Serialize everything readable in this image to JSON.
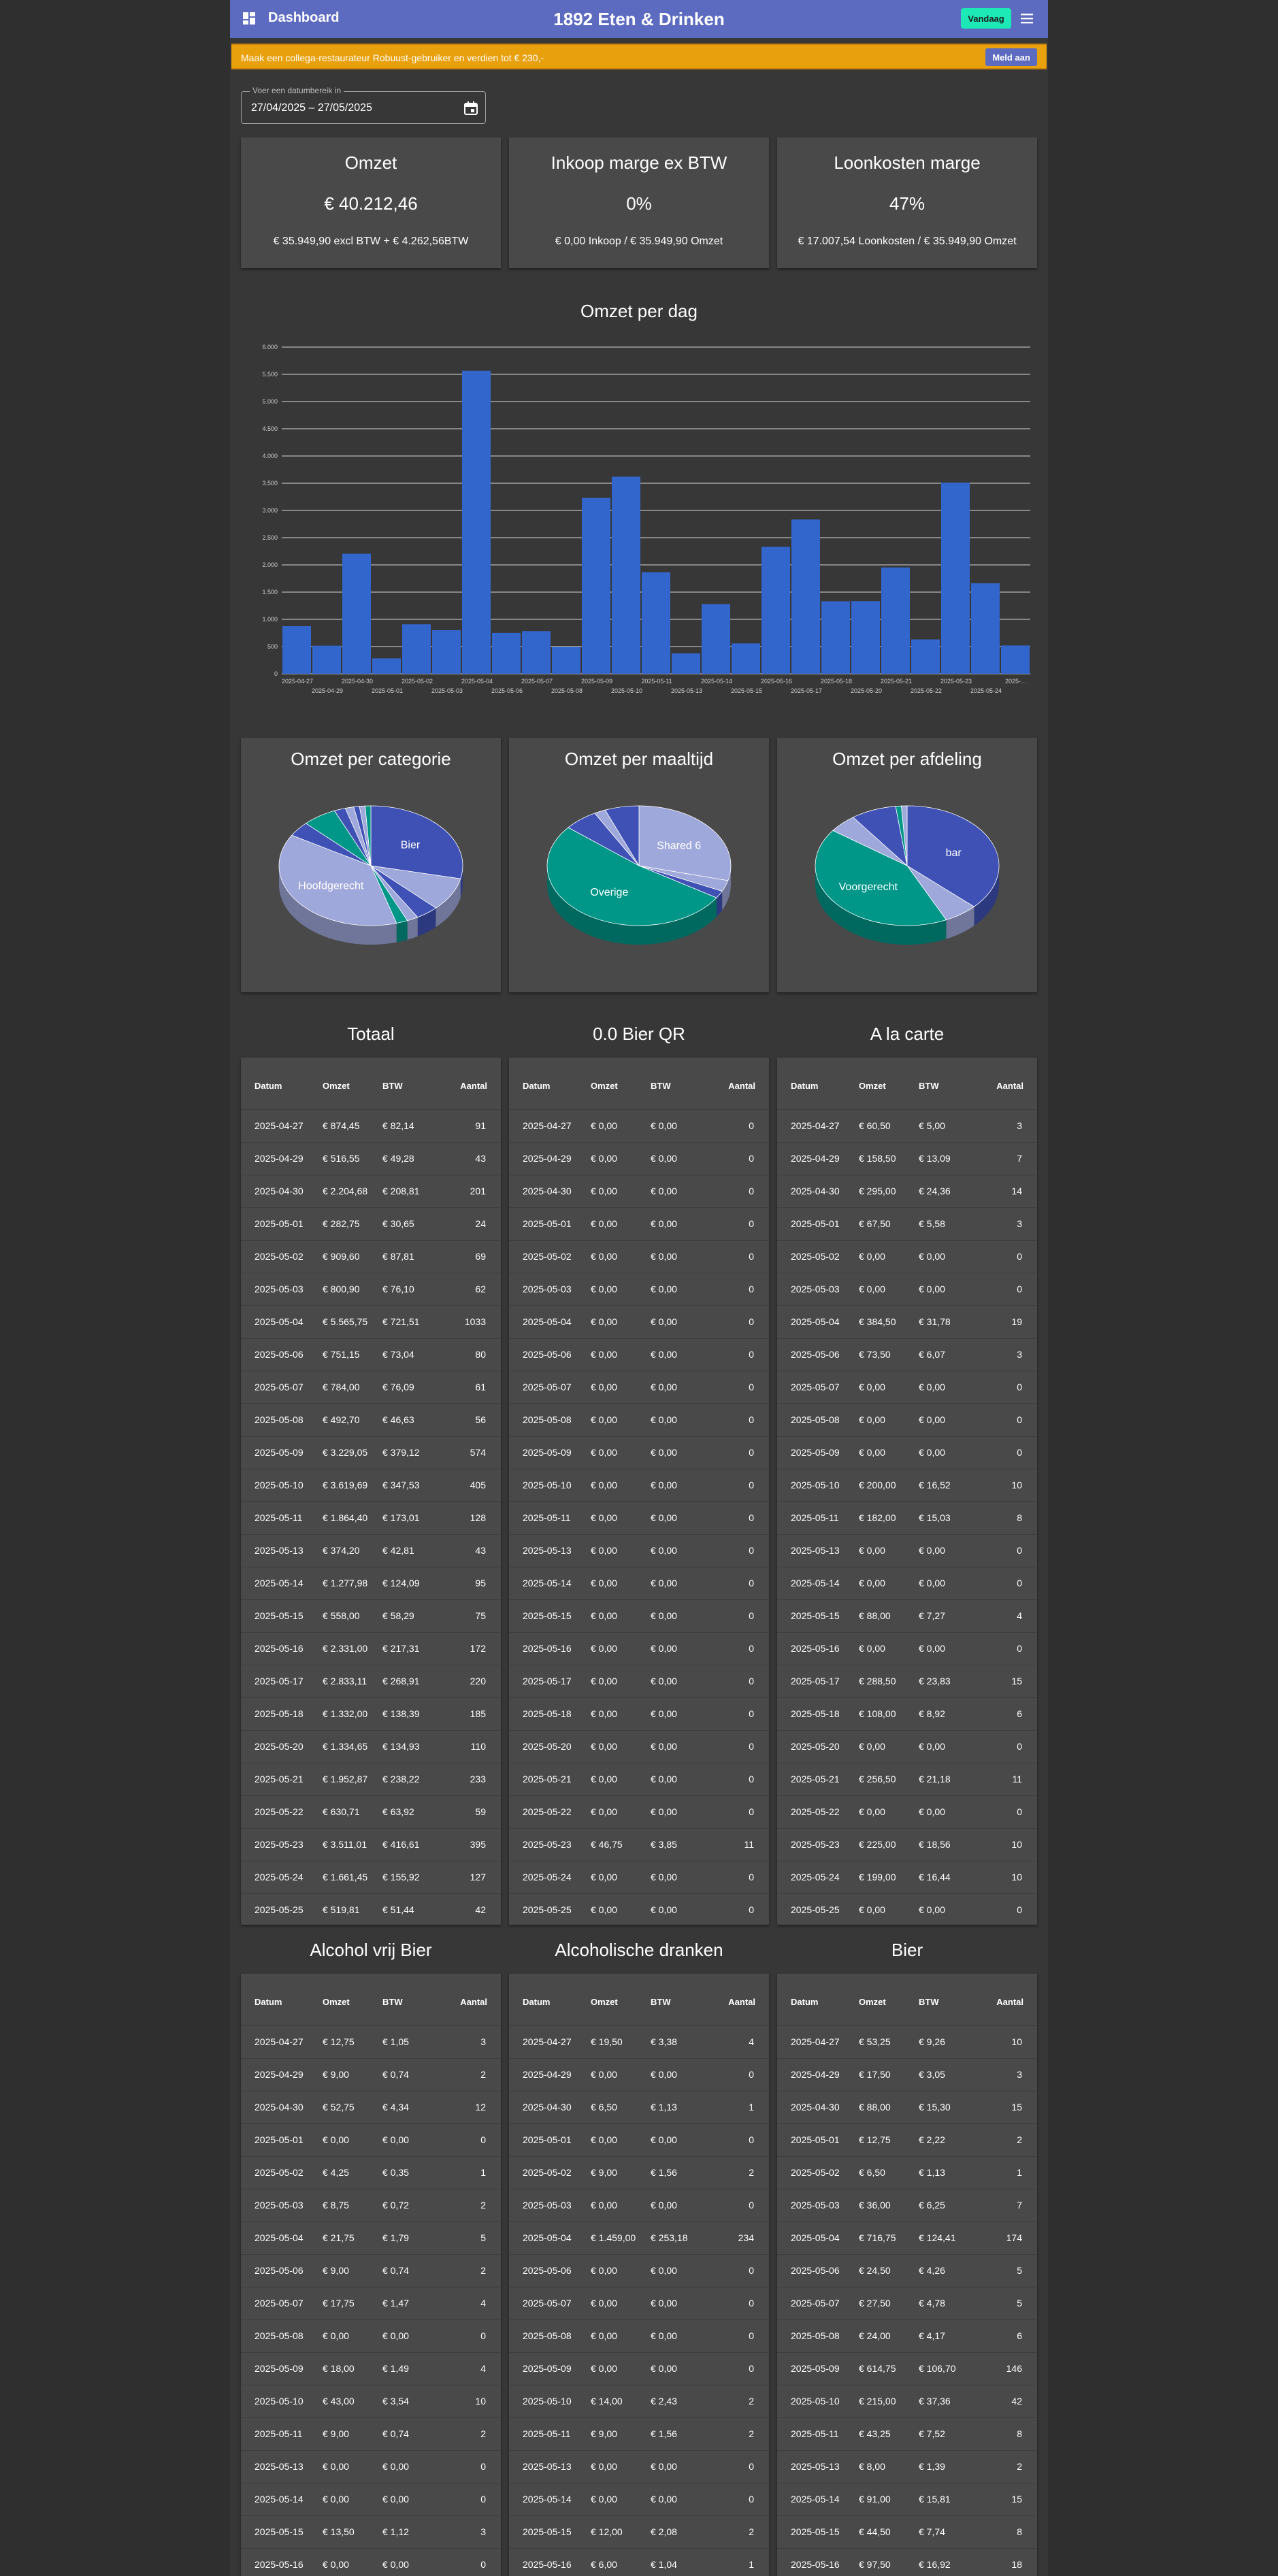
{
  "header": {
    "dashboard_label": "Dashboard",
    "title": "1892 Eten & Drinken",
    "today_button": "Vandaag",
    "dashboard_icon": "dashboard-icon",
    "menu_icon": "hamburger-menu-icon"
  },
  "promo": {
    "text": "Maak een collega-restaurateur Robuust-gebruiker en verdien tot € 230,-",
    "button": "Meld aan"
  },
  "date_range": {
    "label": "Voer een datumbereik in",
    "value": "27/04/2025  –  27/05/2025",
    "icon": "calendar-icon"
  },
  "kpis": [
    {
      "title": "Omzet",
      "value": "€ 40.212,46",
      "sub": "€ 35.949,90 excl BTW + € 4.262,56BTW"
    },
    {
      "title": "Inkoop marge ex BTW",
      "value": "0%",
      "sub": "€ 0,00 Inkoop / € 35.949,90 Omzet"
    },
    {
      "title": "Loonkosten marge",
      "value": "47%",
      "sub": "€ 17.007,54 Loonkosten / € 35.949,90 Omzet"
    }
  ],
  "colors": {
    "accent": "#5c6bc0",
    "bar": "#3366cc",
    "promo": "#e8a00d",
    "today": "#1de9b6"
  },
  "bar_chart_title": "Omzet per dag",
  "chart_data": [
    {
      "type": "bar",
      "title": "Omzet per dag",
      "categories": [
        "2025-04-27",
        "2025-04-29",
        "2025-04-30",
        "2025-05-01",
        "2025-05-02",
        "2025-05-03",
        "2025-05-04",
        "2025-05-06",
        "2025-05-07",
        "2025-05-08",
        "2025-05-09",
        "2025-05-10",
        "2025-05-11",
        "2025-05-13",
        "2025-05-14",
        "2025-05-15",
        "2025-05-16",
        "2025-05-17",
        "2025-05-18",
        "2025-05-20",
        "2025-05-21",
        "2025-05-22",
        "2025-05-23",
        "2025-05-24",
        "2025-05-25"
      ],
      "tick_labels_shown": [
        "2025-04-27",
        "2025-04-29",
        "2025-04-30",
        "2025-05-01",
        "2025-05-02",
        "2025-05-03",
        "2025-05-04",
        "2025-05-06",
        "2025-05-07",
        "2025-05-08",
        "2025-05-09",
        "2025-05-10",
        "2025-05-11",
        "2025-05-13",
        "2025-05-14",
        "2025-05-15",
        "2025-05-16",
        "2025-05-17",
        "2025-05-18",
        "2025-05-20",
        "2025-05-21",
        "2025-05-22",
        "2025-05-23",
        "2025-05-24",
        "2025-…"
      ],
      "values": [
        874.45,
        516.55,
        2204.68,
        282.75,
        909.6,
        800.9,
        5565.75,
        751.15,
        784.0,
        492.7,
        3229.05,
        3619.69,
        1864.4,
        374.2,
        1277.98,
        558.0,
        2331.0,
        2833.11,
        1332.0,
        1334.65,
        1952.87,
        630.71,
        3511.01,
        1661.45,
        519.81
      ],
      "y_ticks": [
        "6.000",
        "5.500",
        "5.000",
        "4.500",
        "4.000",
        "3.500",
        "3.000",
        "2.500",
        "2.000",
        "1.500",
        "1.000",
        "500",
        "0"
      ],
      "ylim": [
        0,
        6000
      ],
      "grid": true
    },
    {
      "type": "pie",
      "title": "Omzet per categorie",
      "slices": [
        {
          "label": "Bier",
          "value": 28.5
        },
        {
          "label": "",
          "value": 9
        },
        {
          "label": "",
          "value": 4
        },
        {
          "label": "",
          "value": 2
        },
        {
          "label": "",
          "value": 2
        },
        {
          "label": "Hoofdgerecht",
          "value": 38
        },
        {
          "label": "",
          "value": 4
        },
        {
          "label": "",
          "value": 6
        },
        {
          "label": "",
          "value": 2
        },
        {
          "label": "",
          "value": 1.5
        },
        {
          "label": "",
          "value": 1
        },
        {
          "label": "",
          "value": 1
        },
        {
          "label": "",
          "value": 1
        }
      ]
    },
    {
      "type": "pie",
      "title": "Omzet per maaltijd",
      "slices": [
        {
          "label": "Shared 6",
          "value": 29
        },
        {
          "label": "",
          "value": 3
        },
        {
          "label": "",
          "value": 2
        },
        {
          "label": "Overige",
          "value": 52
        },
        {
          "label": "",
          "value": 6
        },
        {
          "label": "",
          "value": 2
        },
        {
          "label": "",
          "value": 6
        }
      ]
    },
    {
      "type": "pie",
      "title": "Omzet per afdeling",
      "slices": [
        {
          "label": "bar",
          "value": 37
        },
        {
          "label": "",
          "value": 6
        },
        {
          "label": "Voorgerecht",
          "value": 42
        },
        {
          "label": "",
          "value": 5
        },
        {
          "label": "",
          "value": 8
        },
        {
          "label": "",
          "value": 1
        },
        {
          "label": "",
          "value": 1
        }
      ]
    }
  ],
  "table_headers": [
    "Datum",
    "Omzet",
    "BTW",
    "Aantal"
  ],
  "tables": [
    {
      "title": "Totaal",
      "rows": [
        [
          "2025-04-27",
          "€ 874,45",
          "€ 82,14",
          "91"
        ],
        [
          "2025-04-29",
          "€ 516,55",
          "€ 49,28",
          "43"
        ],
        [
          "2025-04-30",
          "€ 2.204,68",
          "€ 208,81",
          "201"
        ],
        [
          "2025-05-01",
          "€ 282,75",
          "€ 30,65",
          "24"
        ],
        [
          "2025-05-02",
          "€ 909,60",
          "€ 87,81",
          "69"
        ],
        [
          "2025-05-03",
          "€ 800,90",
          "€ 76,10",
          "62"
        ],
        [
          "2025-05-04",
          "€ 5.565,75",
          "€ 721,51",
          "1033"
        ],
        [
          "2025-05-06",
          "€ 751,15",
          "€ 73,04",
          "80"
        ],
        [
          "2025-05-07",
          "€ 784,00",
          "€ 76,09",
          "61"
        ],
        [
          "2025-05-08",
          "€ 492,70",
          "€ 46,63",
          "56"
        ],
        [
          "2025-05-09",
          "€ 3.229,05",
          "€ 379,12",
          "574"
        ],
        [
          "2025-05-10",
          "€ 3.619,69",
          "€ 347,53",
          "405"
        ],
        [
          "2025-05-11",
          "€ 1.864,40",
          "€ 173,01",
          "128"
        ],
        [
          "2025-05-13",
          "€ 374,20",
          "€ 42,81",
          "43"
        ],
        [
          "2025-05-14",
          "€ 1.277,98",
          "€ 124,09",
          "95"
        ],
        [
          "2025-05-15",
          "€ 558,00",
          "€ 58,29",
          "75"
        ],
        [
          "2025-05-16",
          "€ 2.331,00",
          "€ 217,31",
          "172"
        ],
        [
          "2025-05-17",
          "€ 2.833,11",
          "€ 268,91",
          "220"
        ],
        [
          "2025-05-18",
          "€ 1.332,00",
          "€ 138,39",
          "185"
        ],
        [
          "2025-05-20",
          "€ 1.334,65",
          "€ 134,93",
          "110"
        ],
        [
          "2025-05-21",
          "€ 1.952,87",
          "€ 238,22",
          "233"
        ],
        [
          "2025-05-22",
          "€ 630,71",
          "€ 63,92",
          "59"
        ],
        [
          "2025-05-23",
          "€ 3.511,01",
          "€ 416,61",
          "395"
        ],
        [
          "2025-05-24",
          "€ 1.661,45",
          "€ 155,92",
          "127"
        ],
        [
          "2025-05-25",
          "€ 519,81",
          "€ 51,44",
          "42"
        ]
      ]
    },
    {
      "title": "0.0 Bier QR",
      "rows": [
        [
          "2025-04-27",
          "€ 0,00",
          "€ 0,00",
          "0"
        ],
        [
          "2025-04-29",
          "€ 0,00",
          "€ 0,00",
          "0"
        ],
        [
          "2025-04-30",
          "€ 0,00",
          "€ 0,00",
          "0"
        ],
        [
          "2025-05-01",
          "€ 0,00",
          "€ 0,00",
          "0"
        ],
        [
          "2025-05-02",
          "€ 0,00",
          "€ 0,00",
          "0"
        ],
        [
          "2025-05-03",
          "€ 0,00",
          "€ 0,00",
          "0"
        ],
        [
          "2025-05-04",
          "€ 0,00",
          "€ 0,00",
          "0"
        ],
        [
          "2025-05-06",
          "€ 0,00",
          "€ 0,00",
          "0"
        ],
        [
          "2025-05-07",
          "€ 0,00",
          "€ 0,00",
          "0"
        ],
        [
          "2025-05-08",
          "€ 0,00",
          "€ 0,00",
          "0"
        ],
        [
          "2025-05-09",
          "€ 0,00",
          "€ 0,00",
          "0"
        ],
        [
          "2025-05-10",
          "€ 0,00",
          "€ 0,00",
          "0"
        ],
        [
          "2025-05-11",
          "€ 0,00",
          "€ 0,00",
          "0"
        ],
        [
          "2025-05-13",
          "€ 0,00",
          "€ 0,00",
          "0"
        ],
        [
          "2025-05-14",
          "€ 0,00",
          "€ 0,00",
          "0"
        ],
        [
          "2025-05-15",
          "€ 0,00",
          "€ 0,00",
          "0"
        ],
        [
          "2025-05-16",
          "€ 0,00",
          "€ 0,00",
          "0"
        ],
        [
          "2025-05-17",
          "€ 0,00",
          "€ 0,00",
          "0"
        ],
        [
          "2025-05-18",
          "€ 0,00",
          "€ 0,00",
          "0"
        ],
        [
          "2025-05-20",
          "€ 0,00",
          "€ 0,00",
          "0"
        ],
        [
          "2025-05-21",
          "€ 0,00",
          "€ 0,00",
          "0"
        ],
        [
          "2025-05-22",
          "€ 0,00",
          "€ 0,00",
          "0"
        ],
        [
          "2025-05-23",
          "€ 46,75",
          "€ 3,85",
          "11"
        ],
        [
          "2025-05-24",
          "€ 0,00",
          "€ 0,00",
          "0"
        ],
        [
          "2025-05-25",
          "€ 0,00",
          "€ 0,00",
          "0"
        ]
      ]
    },
    {
      "title": "A la carte",
      "rows": [
        [
          "2025-04-27",
          "€ 60,50",
          "€ 5,00",
          "3"
        ],
        [
          "2025-04-29",
          "€ 158,50",
          "€ 13,09",
          "7"
        ],
        [
          "2025-04-30",
          "€ 295,00",
          "€ 24,36",
          "14"
        ],
        [
          "2025-05-01",
          "€ 67,50",
          "€ 5,58",
          "3"
        ],
        [
          "2025-05-02",
          "€ 0,00",
          "€ 0,00",
          "0"
        ],
        [
          "2025-05-03",
          "€ 0,00",
          "€ 0,00",
          "0"
        ],
        [
          "2025-05-04",
          "€ 384,50",
          "€ 31,78",
          "19"
        ],
        [
          "2025-05-06",
          "€ 73,50",
          "€ 6,07",
          "3"
        ],
        [
          "2025-05-07",
          "€ 0,00",
          "€ 0,00",
          "0"
        ],
        [
          "2025-05-08",
          "€ 0,00",
          "€ 0,00",
          "0"
        ],
        [
          "2025-05-09",
          "€ 0,00",
          "€ 0,00",
          "0"
        ],
        [
          "2025-05-10",
          "€ 200,00",
          "€ 16,52",
          "10"
        ],
        [
          "2025-05-11",
          "€ 182,00",
          "€ 15,03",
          "8"
        ],
        [
          "2025-05-13",
          "€ 0,00",
          "€ 0,00",
          "0"
        ],
        [
          "2025-05-14",
          "€ 0,00",
          "€ 0,00",
          "0"
        ],
        [
          "2025-05-15",
          "€ 88,00",
          "€ 7,27",
          "4"
        ],
        [
          "2025-05-16",
          "€ 0,00",
          "€ 0,00",
          "0"
        ],
        [
          "2025-05-17",
          "€ 288,50",
          "€ 23,83",
          "15"
        ],
        [
          "2025-05-18",
          "€ 108,00",
          "€ 8,92",
          "6"
        ],
        [
          "2025-05-20",
          "€ 0,00",
          "€ 0,00",
          "0"
        ],
        [
          "2025-05-21",
          "€ 256,50",
          "€ 21,18",
          "11"
        ],
        [
          "2025-05-22",
          "€ 0,00",
          "€ 0,00",
          "0"
        ],
        [
          "2025-05-23",
          "€ 225,00",
          "€ 18,56",
          "10"
        ],
        [
          "2025-05-24",
          "€ 199,00",
          "€ 16,44",
          "10"
        ],
        [
          "2025-05-25",
          "€ 0,00",
          "€ 0,00",
          "0"
        ]
      ]
    },
    {
      "title": "Alcohol vrij Bier",
      "rows": [
        [
          "2025-04-27",
          "€ 12,75",
          "€ 1,05",
          "3"
        ],
        [
          "2025-04-29",
          "€ 9,00",
          "€ 0,74",
          "2"
        ],
        [
          "2025-04-30",
          "€ 52,75",
          "€ 4,34",
          "12"
        ],
        [
          "2025-05-01",
          "€ 0,00",
          "€ 0,00",
          "0"
        ],
        [
          "2025-05-02",
          "€ 4,25",
          "€ 0,35",
          "1"
        ],
        [
          "2025-05-03",
          "€ 8,75",
          "€ 0,72",
          "2"
        ],
        [
          "2025-05-04",
          "€ 21,75",
          "€ 1,79",
          "5"
        ],
        [
          "2025-05-06",
          "€ 9,00",
          "€ 0,74",
          "2"
        ],
        [
          "2025-05-07",
          "€ 17,75",
          "€ 1,47",
          "4"
        ],
        [
          "2025-05-08",
          "€ 0,00",
          "€ 0,00",
          "0"
        ],
        [
          "2025-05-09",
          "€ 18,00",
          "€ 1,49",
          "4"
        ],
        [
          "2025-05-10",
          "€ 43,00",
          "€ 3,54",
          "10"
        ],
        [
          "2025-05-11",
          "€ 9,00",
          "€ 0,74",
          "2"
        ],
        [
          "2025-05-13",
          "€ 0,00",
          "€ 0,00",
          "0"
        ],
        [
          "2025-05-14",
          "€ 0,00",
          "€ 0,00",
          "0"
        ],
        [
          "2025-05-15",
          "€ 13,50",
          "€ 1,12",
          "3"
        ],
        [
          "2025-05-16",
          "€ 0,00",
          "€ 0,00",
          "0"
        ]
      ]
    },
    {
      "title": "Alcoholische dranken",
      "rows": [
        [
          "2025-04-27",
          "€ 19,50",
          "€ 3,38",
          "4"
        ],
        [
          "2025-04-29",
          "€ 0,00",
          "€ 0,00",
          "0"
        ],
        [
          "2025-04-30",
          "€ 6,50",
          "€ 1,13",
          "1"
        ],
        [
          "2025-05-01",
          "€ 0,00",
          "€ 0,00",
          "0"
        ],
        [
          "2025-05-02",
          "€ 9,00",
          "€ 1,56",
          "2"
        ],
        [
          "2025-05-03",
          "€ 0,00",
          "€ 0,00",
          "0"
        ],
        [
          "2025-05-04",
          "€ 1.459,00",
          "€ 253,18",
          "234"
        ],
        [
          "2025-05-06",
          "€ 0,00",
          "€ 0,00",
          "0"
        ],
        [
          "2025-05-07",
          "€ 0,00",
          "€ 0,00",
          "0"
        ],
        [
          "2025-05-08",
          "€ 0,00",
          "€ 0,00",
          "0"
        ],
        [
          "2025-05-09",
          "€ 0,00",
          "€ 0,00",
          "0"
        ],
        [
          "2025-05-10",
          "€ 14,00",
          "€ 2,43",
          "2"
        ],
        [
          "2025-05-11",
          "€ 9,00",
          "€ 1,56",
          "2"
        ],
        [
          "2025-05-13",
          "€ 0,00",
          "€ 0,00",
          "0"
        ],
        [
          "2025-05-14",
          "€ 0,00",
          "€ 0,00",
          "0"
        ],
        [
          "2025-05-15",
          "€ 12,00",
          "€ 2,08",
          "2"
        ],
        [
          "2025-05-16",
          "€ 6,00",
          "€ 1,04",
          "1"
        ]
      ]
    },
    {
      "title": "Bier",
      "rows": [
        [
          "2025-04-27",
          "€ 53,25",
          "€ 9,26",
          "10"
        ],
        [
          "2025-04-29",
          "€ 17,50",
          "€ 3,05",
          "3"
        ],
        [
          "2025-04-30",
          "€ 88,00",
          "€ 15,30",
          "15"
        ],
        [
          "2025-05-01",
          "€ 12,75",
          "€ 2,22",
          "2"
        ],
        [
          "2025-05-02",
          "€ 6,50",
          "€ 1,13",
          "1"
        ],
        [
          "2025-05-03",
          "€ 36,00",
          "€ 6,25",
          "7"
        ],
        [
          "2025-05-04",
          "€ 716,75",
          "€ 124,41",
          "174"
        ],
        [
          "2025-05-06",
          "€ 24,50",
          "€ 4,26",
          "5"
        ],
        [
          "2025-05-07",
          "€ 27,50",
          "€ 4,78",
          "5"
        ],
        [
          "2025-05-08",
          "€ 24,00",
          "€ 4,17",
          "6"
        ],
        [
          "2025-05-09",
          "€ 614,75",
          "€ 106,70",
          "146"
        ],
        [
          "2025-05-10",
          "€ 215,00",
          "€ 37,36",
          "42"
        ],
        [
          "2025-05-11",
          "€ 43,25",
          "€ 7,52",
          "8"
        ],
        [
          "2025-05-13",
          "€ 8,00",
          "€ 1,39",
          "2"
        ],
        [
          "2025-05-14",
          "€ 91,00",
          "€ 15,81",
          "15"
        ],
        [
          "2025-05-15",
          "€ 44,50",
          "€ 7,74",
          "8"
        ],
        [
          "2025-05-16",
          "€ 97,50",
          "€ 16,92",
          "18"
        ]
      ]
    }
  ]
}
